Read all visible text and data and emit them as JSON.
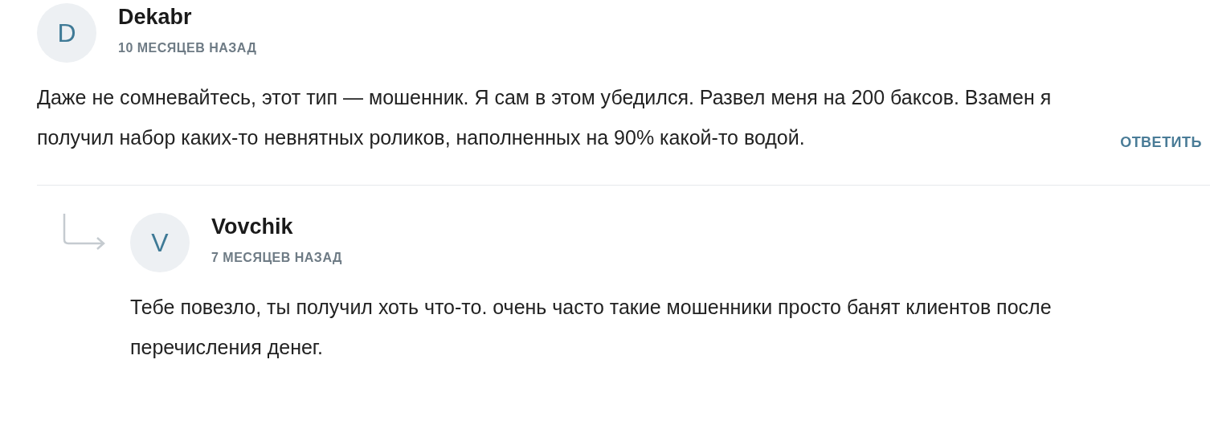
{
  "comments": [
    {
      "author": "Dekabr",
      "initial": "D",
      "time": "10 МЕСЯЦЕВ НАЗАД",
      "text": "Даже не сомневайтесь, этот тип — мошенник. Я сам в этом убедился. Развел меня на 200 баксов. Взамен я получил набор каких-то невнятных роликов, наполненных на 90% какой-то водой.",
      "reply_button": "ОТВЕТИТЬ",
      "replies": [
        {
          "author": "Vovchik",
          "initial": "V",
          "time": "7 МЕСЯЦЕВ НАЗАД",
          "text": "Тебе повезло, ты получил хоть что-то. очень часто такие мошенники просто банят клиентов после перечисления денег."
        }
      ]
    }
  ]
}
